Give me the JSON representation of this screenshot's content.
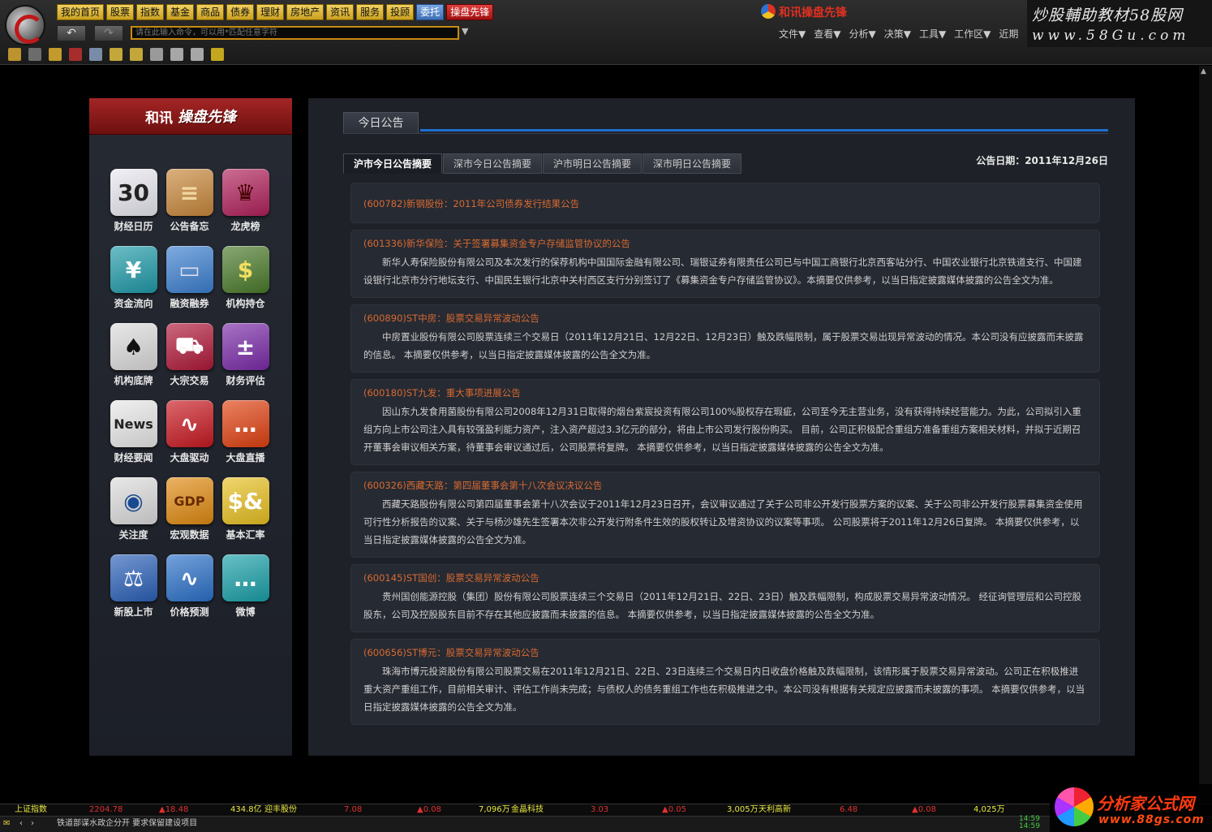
{
  "top_menu": [
    {
      "label": "我的首页",
      "style": "gold"
    },
    {
      "label": "股票",
      "style": "gold"
    },
    {
      "label": "指数",
      "style": "gold"
    },
    {
      "label": "基金",
      "style": "gold"
    },
    {
      "label": "商品",
      "style": "gold"
    },
    {
      "label": "债券",
      "style": "gold"
    },
    {
      "label": "理财",
      "style": "gold"
    },
    {
      "label": "房地产",
      "style": "gold"
    },
    {
      "label": "资讯",
      "style": "gold"
    },
    {
      "label": "服务",
      "style": "gold"
    },
    {
      "label": "投顾",
      "style": "gold"
    },
    {
      "label": "委托",
      "style": "alt"
    },
    {
      "label": "操盘先锋",
      "style": "red"
    }
  ],
  "nav": {
    "back": "↶",
    "forward": "↷",
    "dropdown": "▼"
  },
  "command_input": {
    "placeholder": "请在此输入命令，可以用*匹配任意字符"
  },
  "brand": "和讯操盘先锋",
  "right_menu": [
    "文件▼",
    "查看▼",
    "分析▼",
    "决策▼",
    "工具▼",
    "工作区▼",
    "近期"
  ],
  "watermark": {
    "line1": "炒股輔助教材58股网",
    "line2": "www.58Gu.com"
  },
  "toolbar_icons": [
    {
      "name": "folder-icon",
      "color": "#d8a830"
    },
    {
      "name": "calendar-icon",
      "color": "#7a7a7a"
    },
    {
      "name": "bell-icon",
      "color": "#e0b030"
    },
    {
      "name": "chart-red-icon",
      "color": "#c03030"
    },
    {
      "name": "image-icon",
      "color": "#8aa0c0"
    },
    {
      "name": "line-tool-icon",
      "color": "#e0c040"
    },
    {
      "name": "angle-tool-icon",
      "color": "#e0c040"
    },
    {
      "name": "book-icon",
      "color": "#b0b0b0"
    },
    {
      "name": "news-icon",
      "color": "#c0c0c0"
    },
    {
      "name": "export-icon",
      "color": "#c0c0c0"
    },
    {
      "name": "compass-icon",
      "color": "#e0c020"
    }
  ],
  "left_panel": {
    "logo": "和讯",
    "slogan": "操盘先锋",
    "apps": [
      {
        "label": "财经日历",
        "glyph": "30",
        "bg": "#e8e8f0",
        "fg": "#222",
        "icon": "calendar-icon"
      },
      {
        "label": "公告备忘",
        "glyph": "≡",
        "bg": "#c8873a",
        "fg": "#f0d8a0",
        "icon": "memo-icon"
      },
      {
        "label": "龙虎榜",
        "glyph": "♛",
        "bg": "#b0205a",
        "fg": "#400",
        "icon": "crown-icon"
      },
      {
        "label": "资金流向",
        "glyph": "¥",
        "bg": "#1e9aa8",
        "fg": "#fff",
        "icon": "money-flow-icon"
      },
      {
        "label": "融资融券",
        "glyph": "▭",
        "bg": "#3b7fd0",
        "fg": "#dde",
        "icon": "card-icon"
      },
      {
        "label": "机构持仓",
        "glyph": "$",
        "bg": "#4a7a2a",
        "fg": "#f0e060",
        "icon": "money-bag-icon"
      },
      {
        "label": "机构底牌",
        "glyph": "♠",
        "bg": "#dcdcdc",
        "fg": "#111",
        "icon": "spade-card-icon"
      },
      {
        "label": "大宗交易",
        "glyph": "⛟",
        "bg": "#b01838",
        "fg": "#fff",
        "icon": "cart-icon"
      },
      {
        "label": "财务评估",
        "glyph": "±",
        "bg": "#7a2aa8",
        "fg": "#fff",
        "icon": "calculator-icon"
      },
      {
        "label": "财经要闻",
        "glyph": "News",
        "bg": "#e8e8e8",
        "fg": "#222",
        "icon": "newspaper-icon"
      },
      {
        "label": "大盘驱动",
        "glyph": "∿",
        "bg": "#c81820",
        "fg": "#fff",
        "icon": "pulse-icon"
      },
      {
        "label": "大盘直播",
        "glyph": "…",
        "bg": "#e04010",
        "fg": "#fff",
        "icon": "chat-bubble-icon"
      },
      {
        "label": "关注度",
        "glyph": "◉",
        "bg": "#dcdcdc",
        "fg": "#1a4a90",
        "icon": "eye-icon"
      },
      {
        "label": "宏观数据",
        "glyph": "GDP",
        "bg": "#e08a10",
        "fg": "#6a2a00",
        "icon": "gdp-icon"
      },
      {
        "label": "基本汇率",
        "glyph": "$&",
        "bg": "#e8c020",
        "fg": "#fff",
        "icon": "exchange-icon"
      },
      {
        "label": "新股上市",
        "glyph": "⚖",
        "bg": "#2a60b8",
        "fg": "#fff",
        "icon": "gavel-icon"
      },
      {
        "label": "价格预测",
        "glyph": "∿",
        "bg": "#2a70c8",
        "fg": "#fff",
        "icon": "wave-icon"
      },
      {
        "label": "微博",
        "glyph": "…",
        "bg": "#18a0a8",
        "fg": "#fff",
        "icon": "weibo-bubble-icon"
      }
    ]
  },
  "main": {
    "tab_label": "今日公告",
    "subtabs": [
      "沪市今日公告摘要",
      "深市今日公告摘要",
      "沪市明日公告摘要",
      "深市明日公告摘要"
    ],
    "active_subtab": 0,
    "date_label": "公告日期：2011年12月26日",
    "notices": [
      {
        "title": "(600782)新钢股份：2011年公司债券发行结果公告",
        "body": ""
      },
      {
        "title": "(601336)新华保险：关于签署募集资金专户存储监管协议的公告",
        "body": "新华人寿保险股份有限公司及本次发行的保荐机构中国国际金融有限公司、瑞银证券有限责任公司已与中国工商银行北京西客站分行、中国农业银行北京铁道支行、中国建设银行北京市分行地坛支行、中国民生银行北京中关村西区支行分别签订了《募集资金专户存储监管协议》。本摘要仅供参考，以当日指定披露媒体披露的公告全文为准。"
      },
      {
        "title": "(600890)ST中房：股票交易异常波动公告",
        "body": "中房置业股份有限公司股票连续三个交易日（2011年12月21日、12月22日、12月23日）触及跌幅限制，属于股票交易出现异常波动的情况。本公司没有应披露而未披露的信息。 本摘要仅供参考，以当日指定披露媒体披露的公告全文为准。"
      },
      {
        "title": "(600180)ST九发：重大事项进展公告",
        "body": "因山东九发食用菌股份有限公司2008年12月31日取得的烟台紫宸投资有限公司100%股权存在瑕疵，公司至今无主营业务，没有获得持续经营能力。为此，公司拟引入重组方向上市公司注入具有较强盈利能力资产，注入资产超过3.3亿元的部分，将由上市公司发行股份购买。     目前，公司正积极配合重组方准备重组方案相关材料，并拟于近期召开董事会审议相关方案，待董事会审议通过后，公司股票将复牌。 本摘要仅供参考，以当日指定披露媒体披露的公告全文为准。"
      },
      {
        "title": "(600326)西藏天路：第四届董事会第十八次会议决议公告",
        "body": "西藏天路股份有限公司第四届董事会第十八次会议于2011年12月23日召开，会议审议通过了关于公司非公开发行股票方案的议案、关于公司非公开发行股票募集资金使用可行性分析报告的议案、关于与杨沙雄先生签署本次非公开发行附条件生效的股权转让及增资协议的议案等事项。     公司股票将于2011年12月26日复牌。 本摘要仅供参考，以当日指定披露媒体披露的公告全文为准。"
      },
      {
        "title": "(600145)ST国创：股票交易异常波动公告",
        "body": "贵州国创能源控股（集团）股份有限公司股票连续三个交易日（2011年12月21日、22日、23日）触及跌幅限制，构成股票交易异常波动情况。 经征询管理层和公司控股股东，公司及控股股东目前不存在其他应披露而未披露的信息。 本摘要仅供参考，以当日指定披露媒体披露的公告全文为准。"
      },
      {
        "title": "(600656)ST博元：股票交易异常波动公告",
        "body": "珠海市博元投资股份有限公司股票交易在2011年12月21日、22日、23日连续三个交易日内日收盘价格触及跌幅限制，该情形属于股票交易异常波动。公司正在积极推进重大资产重组工作，目前相关审计、评估工作尚未完成；与债权人的债务重组工作也在积极推进之中。本公司没有根据有关规定应披露而未披露的事项。 本摘要仅供参考，以当日指定披露媒体披露的公告全文为准。"
      }
    ]
  },
  "status_bar": {
    "ticker": [
      {
        "text": "上证指数",
        "color": "#e8e840"
      },
      {
        "text": "2204.78",
        "color": "#e03030"
      },
      {
        "text": "▲18.48",
        "color": "#e03030"
      },
      {
        "text": "434.8亿",
        "color": "#e8e840"
      },
      {
        "text": "迎丰股份",
        "color": "#e8e840"
      },
      {
        "text": "7.08",
        "color": "#e03030"
      },
      {
        "text": "▲0.08",
        "color": "#e03030"
      },
      {
        "text": "7,096万",
        "color": "#e8e840"
      },
      {
        "text": "金晶科技",
        "color": "#e8e840"
      },
      {
        "text": "3.03",
        "color": "#e03030"
      },
      {
        "text": "▲0.05",
        "color": "#e03030"
      },
      {
        "text": "3,005万",
        "color": "#e8e840"
      },
      {
        "text": "天利高新",
        "color": "#e8e840"
      },
      {
        "text": "6.48",
        "color": "#e03030"
      },
      {
        "text": "▲0.08",
        "color": "#e03030"
      },
      {
        "text": "4,025万",
        "color": "#e8e840"
      }
    ],
    "news": "铁道部谋水政企分开 要求保留建设项目",
    "nav_prev": "‹",
    "nav_next": "›",
    "time1": "14:59",
    "time2": "14:59"
  },
  "corner_logo": {
    "name": "分析家公式网",
    "url": "www.88gs.com"
  }
}
